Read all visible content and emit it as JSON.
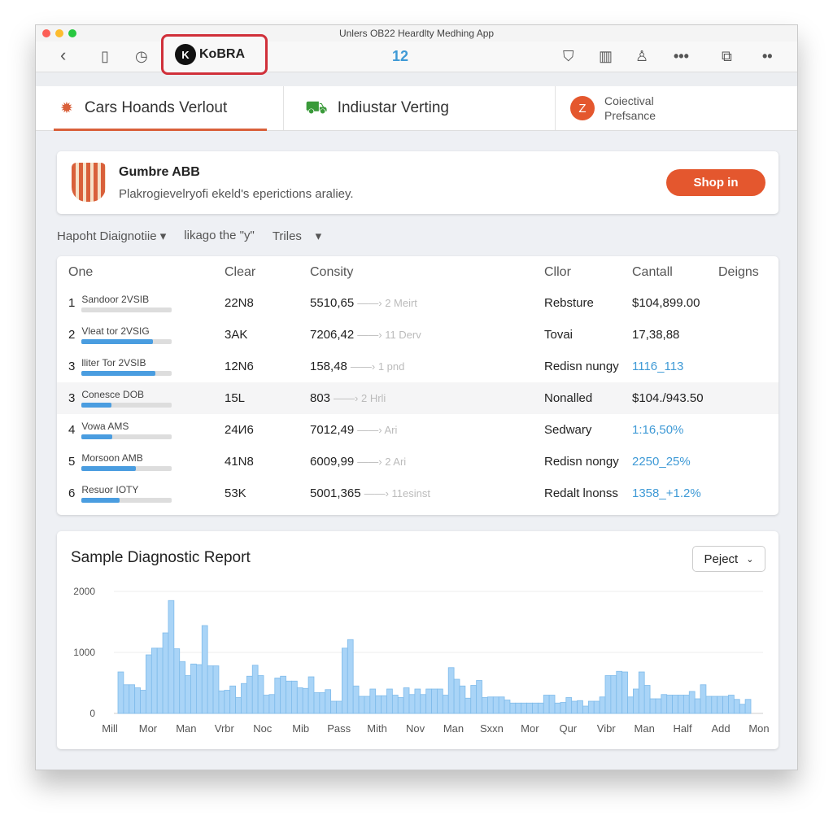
{
  "window": {
    "title": "Unlers OB22 Heardlty Medhing App"
  },
  "toolbar": {
    "logo": "KoBRA",
    "logo_mark": "K",
    "center": "12",
    "icons": [
      "back-icon",
      "clipboard-icon",
      "clock-icon",
      "filter-icon",
      "book-icon",
      "user-icon",
      "more-icon",
      "copy-icon",
      "overflow-icon"
    ]
  },
  "tabs": [
    {
      "label": "Cars Hoands Verlout",
      "active": true
    },
    {
      "label": "Indiustar Verting"
    },
    {
      "label_line1": "Coiectival",
      "label_line2": "Prefsance",
      "badge": "Z"
    }
  ],
  "banner": {
    "title": "Gumbre ABB",
    "subtitle": "Plakrogievelryofi ekeld's eperictions araliey.",
    "button": "Shop in"
  },
  "filters": [
    "Hapoht Diaignotiie",
    "likago the \"y\"",
    "Triles"
  ],
  "table": {
    "headers": [
      "One",
      "Clear",
      "Consity",
      "Cllor",
      "Cantall",
      "Deigns"
    ],
    "rows": [
      {
        "n": "1",
        "name": "Sandoor 2VSIB",
        "progress": 0,
        "clear": "22N8",
        "consity": "5510,65",
        "note": "2 Meirt",
        "cllor": "Rebsture",
        "cantall": "$104,899.00",
        "blue": false
      },
      {
        "n": "2",
        "name": "Vleat tor 2VSIG",
        "progress": 0.79,
        "clear": "3AK",
        "consity": "7206,42",
        "note": "11 Derv",
        "cllor": "Tovai",
        "cantall": "17,38,88",
        "blue": false
      },
      {
        "n": "3",
        "name": "lliter Tor 2VSIB",
        "progress": 0.82,
        "clear": "12N6",
        "consity": "158,48",
        "note": "1 pnd",
        "cllor": "Redisn nungy",
        "cantall": "1116_113",
        "blue": true
      },
      {
        "n": "3",
        "name": "Conesce DOB",
        "progress": 0.33,
        "clear": "15L",
        "consity": "803",
        "note": "2 Hrli",
        "cllor": "Nonalled",
        "cantall": "$104./943.50",
        "blue": false,
        "highlight": true
      },
      {
        "n": "4",
        "name": "Vowa AMS",
        "progress": 0.34,
        "clear": "24И6",
        "consity": "7012,49",
        "note": "Ari",
        "cllor": "Sedwary",
        "cantall": "1:16,50%",
        "blue": true
      },
      {
        "n": "5",
        "name": "Morsoon AMB",
        "progress": 0.6,
        "clear": "41N8",
        "consity": "6009,99",
        "note": "2 Ari",
        "cllor": "Redisn nongy",
        "cantall": "2250_25%",
        "blue": true
      },
      {
        "n": "6",
        "name": "Resuor IOTY",
        "progress": 0.42,
        "clear": "53K",
        "consity": "5001,365",
        "note": "11esinst",
        "cllor": "Redalt lnonss",
        "cantall": "1358_+1.2%",
        "blue": true
      }
    ]
  },
  "report": {
    "title": "Sample Diagnostic Report",
    "select": "Peject"
  },
  "chart_data": {
    "type": "bar",
    "title": "",
    "xlabel": "",
    "ylabel": "",
    "ylim": [
      0,
      2000
    ],
    "yticks": [
      "0",
      "1000",
      "2000"
    ],
    "grid": true,
    "color": "#a9d4f7",
    "xticks": [
      "Mill",
      "Mor",
      "Man",
      "Vrbr",
      "Noc",
      "Mib",
      "Pass",
      "Mith",
      "Nov",
      "Man",
      "Sxxn",
      "Mor",
      "Qur",
      "Vibr",
      "Man",
      "Half",
      "Add",
      "Mon"
    ],
    "values": [
      680,
      470,
      470,
      420,
      380,
      960,
      1070,
      1070,
      1320,
      1850,
      1060,
      850,
      620,
      810,
      800,
      1440,
      780,
      780,
      370,
      380,
      450,
      260,
      490,
      610,
      790,
      620,
      300,
      310,
      580,
      610,
      530,
      530,
      420,
      410,
      600,
      340,
      340,
      390,
      200,
      200,
      1070,
      1210,
      450,
      280,
      280,
      400,
      290,
      290,
      400,
      300,
      260,
      420,
      310,
      400,
      310,
      400,
      400,
      400,
      300,
      750,
      560,
      450,
      250,
      460,
      540,
      260,
      270,
      270,
      270,
      220,
      170,
      170,
      170,
      170,
      170,
      170,
      300,
      300,
      170,
      180,
      260,
      200,
      210,
      120,
      200,
      200,
      270,
      620,
      620,
      690,
      680,
      270,
      400,
      680,
      460,
      240,
      240,
      310,
      300,
      300,
      300,
      300,
      360,
      240,
      470,
      280,
      280,
      280,
      280,
      300,
      230,
      150,
      230
    ]
  }
}
